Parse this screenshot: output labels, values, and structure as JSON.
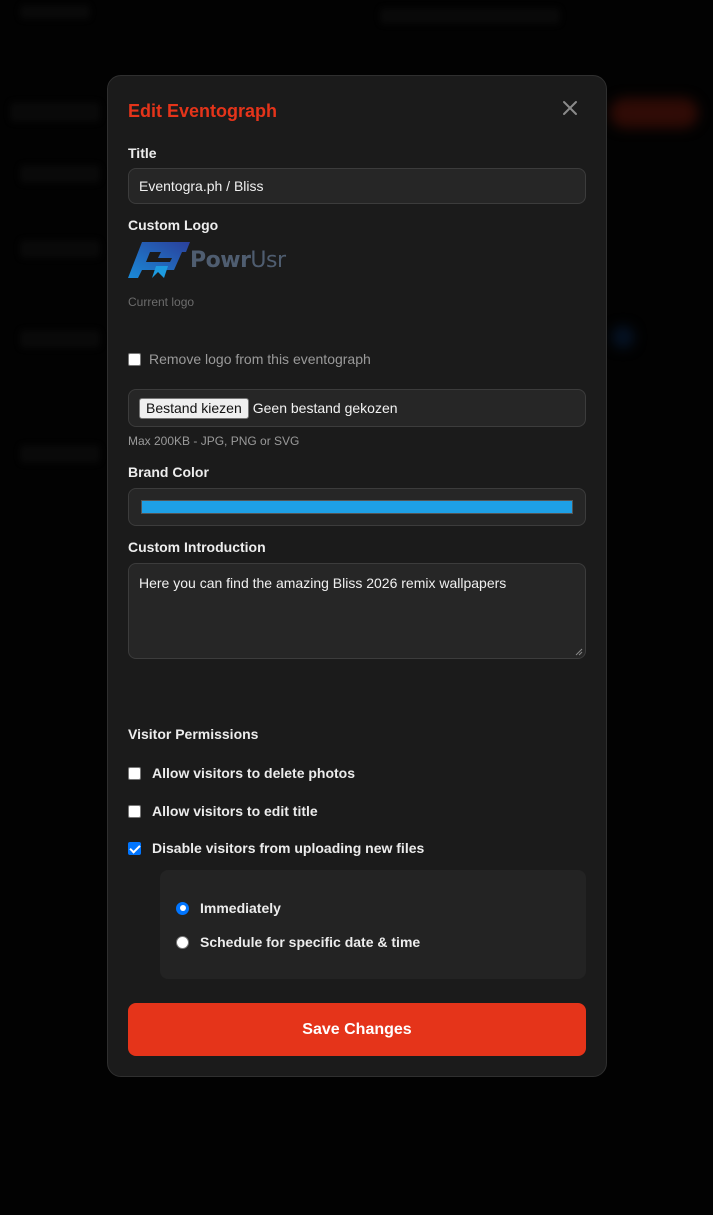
{
  "modal": {
    "title": "Edit Eventograph",
    "close_icon": "close-icon"
  },
  "title_field": {
    "label": "Title",
    "value": "Eventogra.ph / Bliss"
  },
  "custom_logo": {
    "label": "Custom Logo",
    "logo_text_bold": "Powr",
    "logo_text_regular": "Usr",
    "caption": "Current logo",
    "remove_label": "Remove logo from this eventograph",
    "remove_checked": false,
    "file_button": "Bestand kiezen",
    "file_status": "Geen bestand gekozen",
    "hint": "Max 200KB - JPG, PNG or SVG"
  },
  "brand_color": {
    "label": "Brand Color",
    "value": "#1ea0e6"
  },
  "introduction": {
    "label": "Custom Introduction",
    "value": "Here you can find the amazing Bliss 2026 remix wallpapers"
  },
  "permissions": {
    "label": "Visitor Permissions",
    "items": [
      {
        "label": "Allow visitors to delete photos",
        "checked": false
      },
      {
        "label": "Allow visitors to edit title",
        "checked": false
      },
      {
        "label": "Disable visitors from uploading new files",
        "checked": true
      }
    ],
    "schedule_options": [
      {
        "label": "Immediately",
        "selected": true
      },
      {
        "label": "Schedule for specific date & time",
        "selected": false
      }
    ]
  },
  "save_button": "Save Changes",
  "colors": {
    "accent": "#e5341a",
    "modal_bg": "#1b1b1b",
    "checkbox_blue": "#0075ff"
  }
}
